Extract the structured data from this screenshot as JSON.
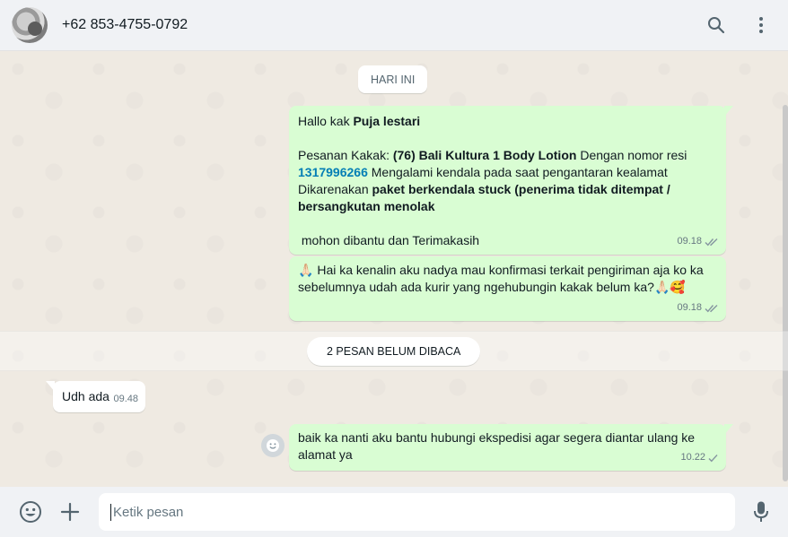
{
  "header": {
    "contact_name": "+62 853-4755-0792",
    "icons": [
      "avatar",
      "search-icon",
      "menu-icon"
    ]
  },
  "chat": {
    "date_chip": "HARI INI",
    "unread_label": "2 PESAN BELUM DIBACA",
    "messages": [
      {
        "direction": "outgoing",
        "greeting_prefix": "Hallo kak ",
        "greeting_name": "Puja lestari",
        "order_prefix": "Pesanan Kakak: ",
        "order_product": "(76) Bali Kultura 1 Body Lotion",
        "order_mid": " Dengan nomor resi",
        "tracking_number": "1317996266",
        "order_suffix": " Mengalami kendala pada saat pengantaran kealamat",
        "reason_prefix": "Dikarenakan ",
        "reason_bold": "paket berkendala stuck (penerima tidak ditempat / bersangkutan menolak",
        "closing": "mohon dibantu dan Terimakasih",
        "time": "09.18",
        "status": "read"
      },
      {
        "direction": "outgoing",
        "text_emoji_start": "🙏🏻",
        "text": " Hai ka kenalin aku nadya mau konfirmasi terkait pengiriman aja ko ka sebelumnya udah ada kurir yang ngehubungin kakak belum ka?",
        "text_emoji_end": "🙏🏻🥰",
        "time": "09.18",
        "status": "read"
      },
      {
        "direction": "incoming",
        "text": "Udh ada",
        "time": "09.48"
      },
      {
        "direction": "outgoing",
        "text": "baik ka nanti aku bantu hubungi ekspedisi agar segera diantar ulang ke alamat ya",
        "time": "10.22",
        "status": "sent"
      }
    ]
  },
  "composer": {
    "placeholder": "Ketik pesan",
    "icons": [
      "emoji-icon",
      "plus-icon",
      "mic-icon"
    ]
  },
  "colors": {
    "outgoing_bubble": "#d9fdd3",
    "incoming_bubble": "#ffffff",
    "link": "#027eb5",
    "chat_background": "#efeae2"
  }
}
